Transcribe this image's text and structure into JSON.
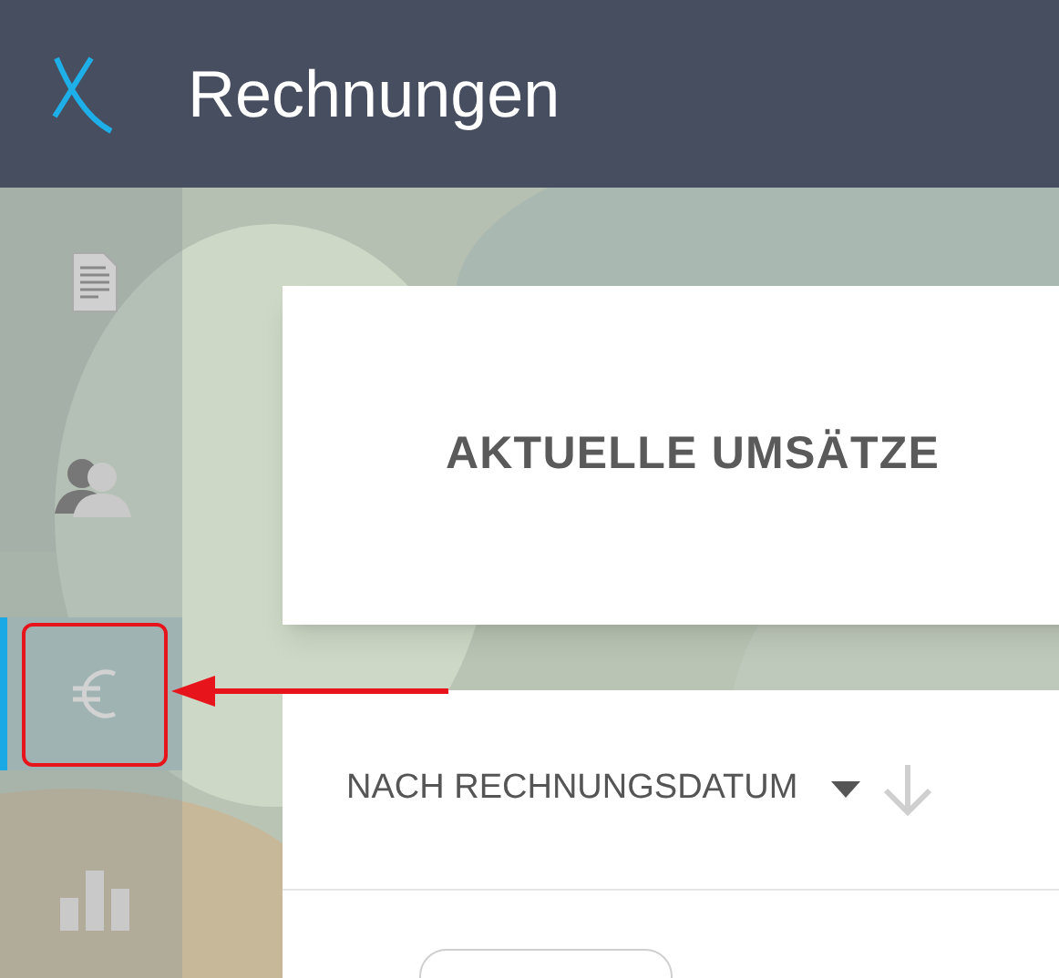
{
  "header": {
    "title": "Rechnungen"
  },
  "sidebar": {
    "items": [
      {
        "kind": "document",
        "selected": false
      },
      {
        "kind": "users",
        "selected": false
      },
      {
        "kind": "euro",
        "selected": true
      },
      {
        "kind": "chart",
        "selected": false
      }
    ]
  },
  "summary_card": {
    "title": "AKTUELLE UMSÄTZE"
  },
  "list_card": {
    "sort_label": "NACH RECHNUNGSDATUM"
  }
}
